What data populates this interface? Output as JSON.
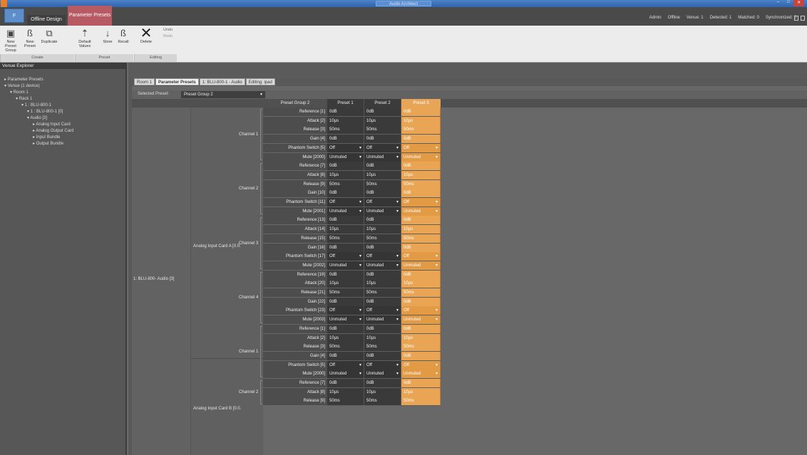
{
  "app": {
    "title": "Audio Architect",
    "window_controls": [
      "–",
      "□",
      "✕"
    ]
  },
  "ribbon_tabs": {
    "file": "F",
    "offline_design": "Offline Design",
    "parameter_presets": "Parameter Presets"
  },
  "status": [
    "Admin",
    "Offline",
    "Venue: 1",
    "Detected: 1",
    "Matched: 0",
    "Synchronized: 0"
  ],
  "ribbon": {
    "buttons": [
      {
        "label": "New Preset Group",
        "icon": "new-preset-group-icon"
      },
      {
        "label": "New Preset",
        "icon": "new-preset-icon"
      },
      {
        "label": "Duplicate",
        "icon": "duplicate-icon"
      },
      {
        "label": "Default Values",
        "icon": "default-values-icon"
      },
      {
        "label": "Store",
        "icon": "store-icon"
      },
      {
        "label": "Recall",
        "icon": "recall-icon"
      },
      {
        "label": "Delete",
        "icon": "delete-icon"
      }
    ],
    "undo": "Undo",
    "redo": "Redo",
    "groups": [
      "Create",
      "Preset",
      "Editing"
    ]
  },
  "explorer": {
    "title": "Venue Explorer",
    "items": [
      {
        "label": "Parameter Presets",
        "level": 0
      },
      {
        "label": "Venue (1 device)",
        "level": 0
      },
      {
        "label": "Room 1",
        "level": 1
      },
      {
        "label": "Rack 1",
        "level": 2
      },
      {
        "label": "1 : BLU-800-1",
        "level": 3
      },
      {
        "label": "1 : BLU-800-1 [0]",
        "level": 4
      },
      {
        "label": "Audio [3]",
        "level": 4
      },
      {
        "label": "Analog Input Card",
        "level": 5
      },
      {
        "label": "Analog Output Card",
        "level": 5
      },
      {
        "label": "Input Bundle",
        "level": 5
      },
      {
        "label": "Output Bundle",
        "level": 5
      }
    ]
  },
  "doc_tabs": [
    "Room 1",
    "Parameter Presets",
    "1: BLU-800-1 - Audio",
    "Editing: ipad"
  ],
  "selected_preset": {
    "label": "Selected Preset:",
    "value": "Preset Group 2"
  },
  "grid": {
    "group_header": "Preset Group 2",
    "presets": [
      "Preset 1",
      "Preset 2",
      "Preset 3"
    ],
    "device_label": "1: BLU-800- Audio [3]",
    "cards": [
      {
        "label": "Analog Input Card A [0.0.",
        "channels": [
          {
            "label": "Channel 1",
            "params": [
              {
                "name": "Reference [1]",
                "values": [
                  "0dB",
                  "0dB",
                  "0dB"
                ]
              },
              {
                "name": "Attack [2]",
                "values": [
                  "10µs",
                  "10µs",
                  "10µs"
                ]
              },
              {
                "name": "Release [3]",
                "values": [
                  "50ms",
                  "50ms",
                  "50ms"
                ]
              },
              {
                "name": "Gain [4]",
                "values": [
                  "0dB",
                  "0dB",
                  "0dB"
                ]
              },
              {
                "name": "Phantom Switch [5]",
                "values": [
                  "Off",
                  "Off",
                  "Off"
                ],
                "dropdown": true
              },
              {
                "name": "Mute [2000]",
                "values": [
                  "Unmuted",
                  "Unmuted",
                  "Unmuted"
                ],
                "dropdown": true
              }
            ]
          },
          {
            "label": "Channel 2",
            "params": [
              {
                "name": "Reference [7]",
                "values": [
                  "0dB",
                  "0dB",
                  "0dB"
                ]
              },
              {
                "name": "Attack [8]",
                "values": [
                  "10µs",
                  "10µs",
                  "10µs"
                ]
              },
              {
                "name": "Release [9]",
                "values": [
                  "50ms",
                  "50ms",
                  "50ms"
                ]
              },
              {
                "name": "Gain [10]",
                "values": [
                  "0dB",
                  "0dB",
                  "0dB"
                ]
              },
              {
                "name": "Phantom Switch [11]",
                "values": [
                  "Off",
                  "Off",
                  "Off"
                ],
                "dropdown": true
              },
              {
                "name": "Mute [2001]",
                "values": [
                  "Unmuted",
                  "Unmuted",
                  "Unmuted"
                ],
                "dropdown": true
              }
            ]
          },
          {
            "label": "Channel 3",
            "params": [
              {
                "name": "Reference [13]",
                "values": [
                  "0dB",
                  "0dB",
                  "0dB"
                ]
              },
              {
                "name": "Attack [14]",
                "values": [
                  "10µs",
                  "10µs",
                  "10µs"
                ]
              },
              {
                "name": "Release [15]",
                "values": [
                  "50ms",
                  "50ms",
                  "50ms"
                ]
              },
              {
                "name": "Gain [16]",
                "values": [
                  "0dB",
                  "0dB",
                  "0dB"
                ]
              },
              {
                "name": "Phantom Switch [17]",
                "values": [
                  "Off",
                  "Off",
                  "Off"
                ],
                "dropdown": true
              },
              {
                "name": "Mute [2002]",
                "values": [
                  "Unmuted",
                  "Unmuted",
                  "Unmuted"
                ],
                "dropdown": true
              }
            ]
          },
          {
            "label": "Channel 4",
            "params": [
              {
                "name": "Reference [19]",
                "values": [
                  "0dB",
                  "0dB",
                  "0dB"
                ]
              },
              {
                "name": "Attack [20]",
                "values": [
                  "10µs",
                  "10µs",
                  "10µs"
                ]
              },
              {
                "name": "Release [21]",
                "values": [
                  "50ms",
                  "50ms",
                  "50ms"
                ]
              },
              {
                "name": "Gain [22]",
                "values": [
                  "0dB",
                  "0dB",
                  "0dB"
                ]
              },
              {
                "name": "Phantom Switch [23]",
                "values": [
                  "Off",
                  "Off",
                  "Off"
                ],
                "dropdown": true
              },
              {
                "name": "Mute [2003]",
                "values": [
                  "Unmuted",
                  "Unmuted",
                  "Unmuted"
                ],
                "dropdown": true
              }
            ]
          }
        ]
      },
      {
        "label": "Analog Input Card B [0.0.",
        "channels": [
          {
            "label": "Channel 1",
            "params": [
              {
                "name": "Reference [1]",
                "values": [
                  "0dB",
                  "0dB",
                  "0dB"
                ]
              },
              {
                "name": "Attack [2]",
                "values": [
                  "10µs",
                  "10µs",
                  "10µs"
                ]
              },
              {
                "name": "Release [3]",
                "values": [
                  "50ms",
                  "50ms",
                  "50ms"
                ]
              },
              {
                "name": "Gain [4]",
                "values": [
                  "0dB",
                  "0dB",
                  "0dB"
                ]
              },
              {
                "name": "Phantom Switch [5]",
                "values": [
                  "Off",
                  "Off",
                  "Off"
                ],
                "dropdown": true
              },
              {
                "name": "Mute [2000]",
                "values": [
                  "Unmuted",
                  "Unmuted",
                  "Unmuted"
                ],
                "dropdown": true
              }
            ]
          },
          {
            "label": "Channel 2",
            "params": [
              {
                "name": "Reference [7]",
                "values": [
                  "0dB",
                  "0dB",
                  "0dB"
                ]
              },
              {
                "name": "Attack [8]",
                "values": [
                  "10µs",
                  "10µs",
                  "10µs"
                ]
              },
              {
                "name": "Release [9]",
                "values": [
                  "50ms",
                  "50ms",
                  "50ms"
                ]
              }
            ]
          }
        ]
      }
    ]
  },
  "colors": {
    "accent_preset": "#e9a553",
    "file_button": "#5e8ec9",
    "active_ribbon_tab": "#b85a64"
  }
}
